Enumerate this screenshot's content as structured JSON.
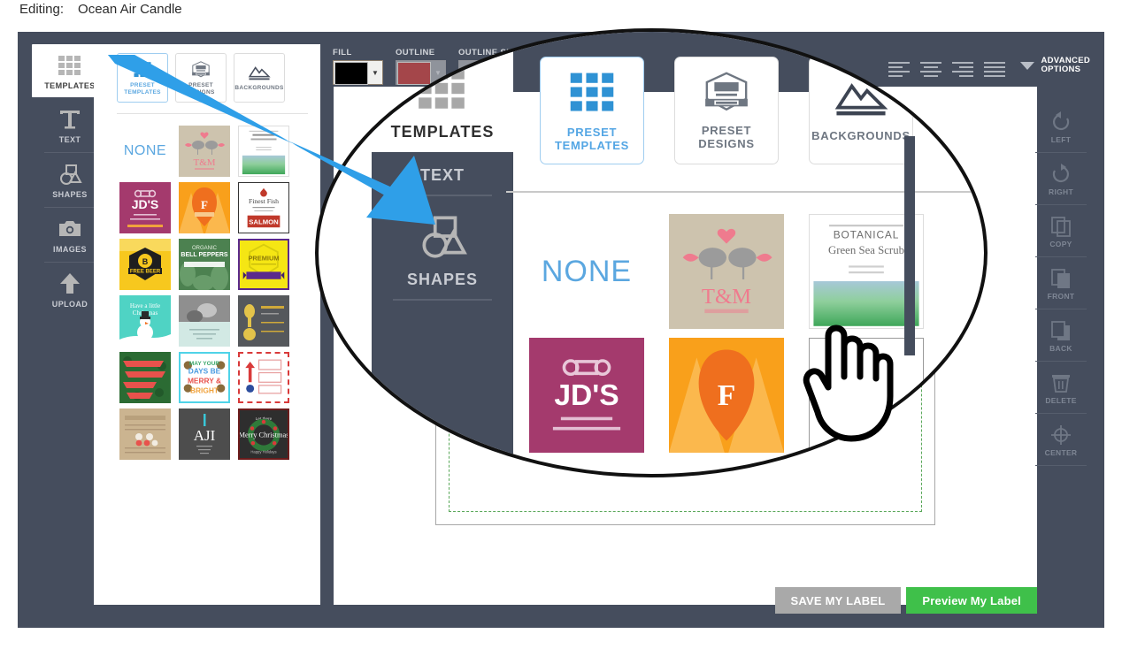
{
  "header": {
    "label": "Editing:",
    "project_name": "Ocean Air Candle"
  },
  "left_rail": {
    "items": [
      {
        "label": "TEMPLATES",
        "icon": "grid-icon",
        "active": true
      },
      {
        "label": "TEXT",
        "icon": "text-t-icon",
        "active": false
      },
      {
        "label": "SHAPES",
        "icon": "shapes-icon",
        "active": false
      },
      {
        "label": "IMAGES",
        "icon": "camera-icon",
        "active": false
      },
      {
        "label": "UPLOAD",
        "icon": "upload-arrow-icon",
        "active": false
      }
    ]
  },
  "panel": {
    "tabs": [
      {
        "label": "PRESET TEMPLATES",
        "icon": "blue-grid-icon",
        "selected": true
      },
      {
        "label": "PRESET DESIGNS",
        "icon": "badge-icon",
        "selected": false
      },
      {
        "label": "BACKGROUNDS",
        "icon": "mountain-icon",
        "selected": false
      }
    ],
    "none_label": "NONE",
    "thumbnails": [
      {
        "name": "t-and-m-birds",
        "caption": "T&M",
        "bg": "#cdc3ae"
      },
      {
        "name": "botanical-green-sea-scrub",
        "caption": "BOTANICAL",
        "subcaption": "Green Sea Scrub",
        "bg": "#ffffff"
      },
      {
        "name": "jds-chicken-flavored",
        "caption": "JD'S",
        "bg": "#a43a6d"
      },
      {
        "name": "orange-f-badge",
        "caption": "F",
        "bg": "#f9a01b"
      },
      {
        "name": "salmon-label",
        "caption": "SALMON",
        "bg": "#ffffff"
      },
      {
        "name": "free-beer-badge",
        "caption": "FREE BEER",
        "bg": "#f7c81e"
      },
      {
        "name": "organic-bell-peppers",
        "caption": "ORGANIC BELL PEPPERS",
        "bg": "#4a7f4a"
      },
      {
        "name": "premium-yellow-ribbon",
        "caption": "PREMIUM",
        "bg": "#f5e614"
      },
      {
        "name": "snowman-christmas",
        "caption": "Have a little Christmas",
        "bg": "#4fd3c4"
      },
      {
        "name": "grayscale-photo-card",
        "caption": "",
        "bg": "#cfe6e2"
      },
      {
        "name": "dark-gold-menu",
        "caption": "",
        "bg": "#55585c"
      },
      {
        "name": "red-green-banners",
        "caption": "",
        "bg": "#2e6b34"
      },
      {
        "name": "merry-days-bright",
        "caption": "MAY YOUR DAYS BE MERRY & BRIGHT",
        "bg": "#ffffff"
      },
      {
        "name": "red-dashed-arrow",
        "caption": "",
        "bg": "#ffffff"
      },
      {
        "name": "kraft-paper-list",
        "caption": "",
        "bg": "#c9b18c"
      },
      {
        "name": "aji-dark",
        "caption": "AJI",
        "bg": "#4d4d4d"
      },
      {
        "name": "merry-christmas-wreath",
        "caption": "Merry Christmas",
        "bg": "#2e2e2e"
      }
    ]
  },
  "toolbar": {
    "fill": {
      "label": "FILL",
      "color": "#000000"
    },
    "outline": {
      "label": "OUTLINE",
      "color": "#a4464a",
      "disabled": true
    },
    "outline_size": {
      "label": "OUTLINE SIZE",
      "disabled": true
    },
    "align_icons": [
      "align-left-icon",
      "align-center-icon",
      "align-right-icon",
      "align-justify-icon"
    ],
    "advanced_options": {
      "label_line1": "ADVANCED",
      "label_line2": "OPTIONS",
      "icon": "triangle-down-icon"
    }
  },
  "right_rail": {
    "items": [
      {
        "label": "LEFT",
        "icon": "rotate-left-icon"
      },
      {
        "label": "RIGHT",
        "icon": "rotate-right-icon"
      },
      {
        "label": "COPY",
        "icon": "copy-icon"
      },
      {
        "label": "FRONT",
        "icon": "bring-front-icon"
      },
      {
        "label": "BACK",
        "icon": "send-back-icon"
      },
      {
        "label": "DELETE",
        "icon": "trash-icon"
      },
      {
        "label": "CENTER",
        "icon": "center-target-icon"
      }
    ]
  },
  "footer": {
    "save_label": "SAVE MY LABEL",
    "preview_label": "Preview My Label",
    "save_color": "#a9a9a9",
    "preview_color": "#3fc04a"
  },
  "annotations": {
    "arrow": {
      "name": "blue-pointer-arrow",
      "color": "#2f9fe8"
    },
    "magnifier": {
      "name": "magnifier-ellipse",
      "border_color": "#111111"
    },
    "cursor": {
      "name": "pointing-hand-cursor"
    }
  },
  "colors": {
    "app_chrome": "#454d5d",
    "accent_blue": "#5ba7e0",
    "panel_white": "#ffffff",
    "safe_guide": "#5aa85a"
  }
}
